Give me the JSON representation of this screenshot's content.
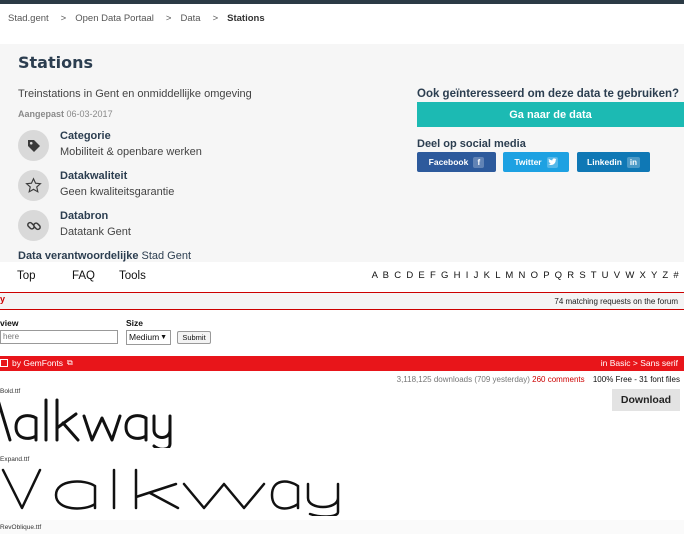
{
  "breadcrumb": {
    "items": [
      "Stad.gent",
      "Open Data Portaal",
      "Data",
      "Stations"
    ],
    "separator": ">"
  },
  "dataset": {
    "title": "Stations",
    "description": "Treinstations in Gent en onmiddellijke omgeving",
    "adapted_label": "Aangepast",
    "adapted_date": "06-03-2017",
    "meta": [
      {
        "label": "Categorie",
        "value": "Mobiliteit & openbare werken",
        "icon": "tag-icon"
      },
      {
        "label": "Datakwaliteit",
        "value": "Geen kwaliteitsgarantie",
        "icon": "star-icon"
      },
      {
        "label": "Databron",
        "value": "Datatank Gent",
        "icon": "link-icon"
      }
    ],
    "owner_label": "Data verantwoordelijke",
    "owner_value": "Stad Gent"
  },
  "sidebar": {
    "interest_question": "Ook geïnteresseerd om deze data te gebruiken?",
    "go_button": "Ga naar de data",
    "share_title": "Deel op social media",
    "share_buttons": [
      {
        "label": "Facebook",
        "icon": "f",
        "color": "#2d5a9c"
      },
      {
        "label": "Twitter",
        "icon": "t",
        "color": "#1da1e2"
      },
      {
        "label": "Linkedin",
        "icon": "in",
        "color": "#0f78b5"
      }
    ]
  },
  "colors": {
    "accent": "#1cbab3",
    "heading": "#2c3e50",
    "fontsite_red": "#e8151a"
  },
  "fontsite": {
    "nav": [
      "Top",
      "FAQ",
      "Tools"
    ],
    "alphabet": "A B C D E F G H I J K L M N O P Q R S T U V W X Y Z #",
    "forum_left": "y",
    "forum_count": "74 matching requests on the forum",
    "preview_label": "view",
    "preview_placeholder": "here",
    "size_label": "Size",
    "size_value": "Medium",
    "submit_label": "Submit",
    "font_by": "by GemFonts",
    "font_category": "in Basic > Sans serif",
    "downloads": "3,118,125 downloads (709 yesterday)",
    "comments": "260 comments",
    "license": "100% Free - 31 font files",
    "download_button": "Download",
    "samples": [
      {
        "file": "Bold.ttf",
        "text": "Valkway"
      },
      {
        "file": "Expand.ttf",
        "text": "Valkway"
      },
      {
        "file": "RevOblique.ttf",
        "text": ""
      }
    ]
  }
}
